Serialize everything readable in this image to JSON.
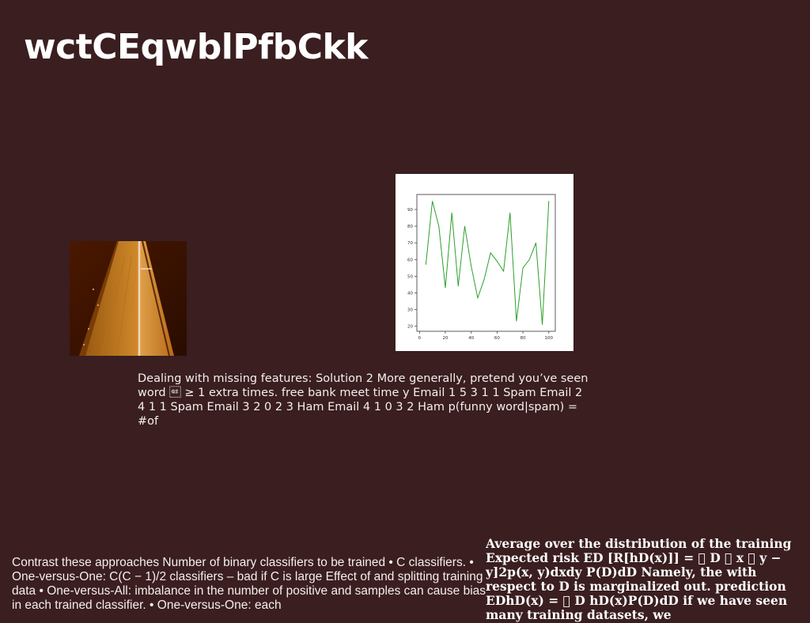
{
  "title": "wctCEqwblPfbCkk",
  "image": {
    "icon": "orange-fabric-triangle-photo"
  },
  "caption": "Dealing with missing features: Solution 2 More generally, pretend you’ve seen word \u001d ≥ 1 extra times. free bank meet time y Email 1 5 3 1 1 Spam Email 2 4 1 1 Spam Email 3 2 0 2 3 Ham Email 4 1 0 3 2 Ham p(funny word|spam) = #of",
  "bottom_left_text": "Contrast these approaches Number of binary classifiers to be trained • C classifiers. • One-versus-One: C(C − 1)/2 classifiers – bad if C is large Effect of and splitting training data • One-versus-All: imbalance in the number of positive and samples can cause bias in each trained classifier. • One-versus-One: each",
  "bottom_right_text": "Average over the distribution of the training Expected risk ED [R[hD(x)]] = \u0000 D \u0000 x \u0000 y − y]2p(x, y)dxdy P(D)dD Namely, the with respect to D is marginalized out. prediction EDhD(x) = \u0000 D hD(x)P(D)dD if we have seen many training datasets, we",
  "chart_data": {
    "type": "line",
    "x": [
      5,
      10,
      15,
      20,
      25,
      30,
      35,
      40,
      45,
      50,
      55,
      60,
      65,
      70,
      75,
      80,
      85,
      90,
      95,
      100
    ],
    "values": [
      57,
      95,
      80,
      43,
      88,
      44,
      80,
      56,
      37,
      48,
      64,
      59,
      53,
      88,
      23,
      55,
      60,
      70,
      21,
      95
    ],
    "x_ticks": [
      "0",
      "20",
      "40",
      "60",
      "80",
      "100"
    ],
    "y_ticks": [
      "20",
      "30",
      "40",
      "50",
      "60",
      "70",
      "80",
      "90"
    ],
    "xlim": [
      -2,
      105
    ],
    "ylim": [
      17,
      99
    ],
    "line_color": "#2ca02c",
    "title": "",
    "xlabel": "",
    "ylabel": ""
  }
}
